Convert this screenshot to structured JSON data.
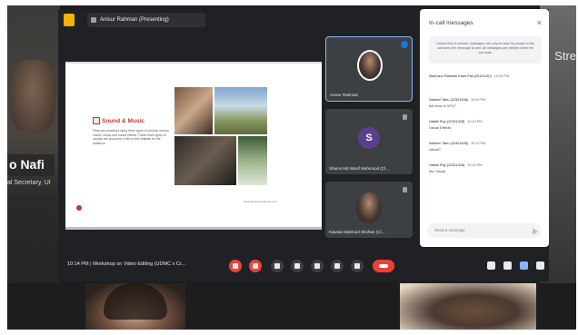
{
  "background": {
    "left_name": "o Nafi",
    "left_subtitle": "al Secretary, UI",
    "right_partial_text": "Stre"
  },
  "topbar": {
    "presenter_label": "Anisur Rahman (Presenting)"
  },
  "slide": {
    "heading": "Sound & Music",
    "body": "Films are produced using three types of sounds: human voices, music and sound effects. These three types of sounds are crucial for a film to feel realistic for the audience.",
    "footer": "www.iamanisurrahman.com"
  },
  "participants": [
    {
      "name": "Anisur Rahman",
      "avatar_type": "photo"
    },
    {
      "name": "Shams Md Wasif Mahmood (Cl...",
      "avatar_letter": "S",
      "avatar_type": "letter"
    },
    {
      "name": "Kawsar Mahmud Shohan (Cl...",
      "avatar_type": "photo"
    }
  ],
  "chat": {
    "title": "In-call messages",
    "close_icon": "×",
    "notice": "Unless they're pinned, messages can only be seen by people in the call when the message is sent. All messages are deleted when the call ends.",
    "messages": [
      {
        "sender": "Mahfuzur Rahman Khan Pali (20101130)",
        "time": "10:09 PM",
        "text": ""
      },
      {
        "sender": "Naheen Tabu (22301408)",
        "time": "10:09 PM",
        "text": "full form of VFX?"
      },
      {
        "sender": "Ufabbi Roy (22301328)",
        "time": "10:10 PM",
        "text": "Visual Effects"
      },
      {
        "sender": "Naheen Tabu (22301408)",
        "time": "10:10 PM",
        "text": "virtual?"
      },
      {
        "sender": "Ufabbi Roy (22301328)",
        "time": "10:10 PM",
        "text": "No, Visual"
      }
    ],
    "input_placeholder": "Send a message"
  },
  "controls": {
    "time": "10:14 PM",
    "meeting_title": "Workshop on Video Editing (UDMC x Cr...",
    "icons": [
      "mic-off-icon",
      "camera-off-icon",
      "captions-icon",
      "emoji-icon",
      "present-icon",
      "raise-hand-icon",
      "more-options-icon",
      "end-call-icon"
    ],
    "right_icons": [
      "info-icon",
      "people-icon",
      "chat-icon",
      "activities-icon"
    ]
  },
  "colors": {
    "meet_bg": "#202124",
    "tile_bg": "#3c4043",
    "end_call": "#ea4335",
    "accent": "#8ab4f8",
    "letter_avatar": "#5b3f8c"
  }
}
